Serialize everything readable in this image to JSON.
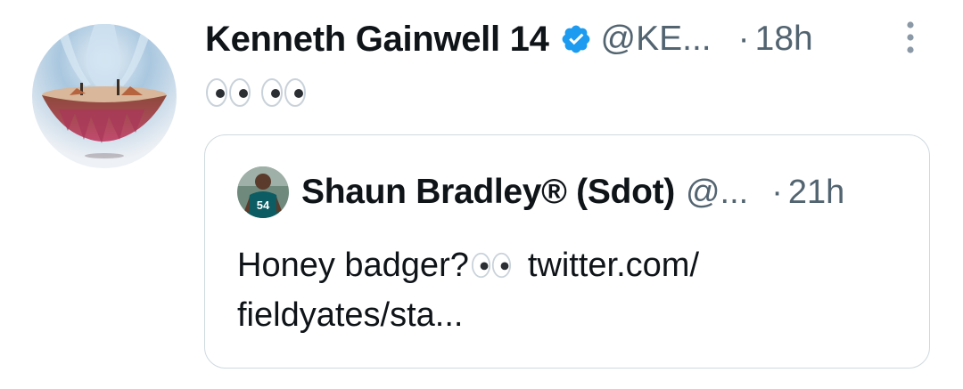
{
  "tweet": {
    "author": {
      "display_name": "Kenneth Gainwell 14",
      "handle": "@KE...",
      "verified_icon": "verified-badge-icon",
      "avatar_icon": "floating-island-avatar"
    },
    "separator": "·",
    "time": "18h",
    "more_icon": "more-vertical-icon",
    "text_icon": "eyes-emoji"
  },
  "quote": {
    "author": {
      "display_name": "Shaun Bradley® (Sdot)",
      "handle": "@...",
      "avatar_icon": "player-avatar"
    },
    "separator": "·",
    "time": "21h",
    "text_line1_prefix": "Honey badger?",
    "text_line1_suffix": "twitter.com/",
    "text_line2": "fieldyates/sta..."
  },
  "colors": {
    "text_primary": "#0f1419",
    "text_secondary": "#536471",
    "verified_blue": "#1d9bf0",
    "border": "#cfd9de"
  }
}
